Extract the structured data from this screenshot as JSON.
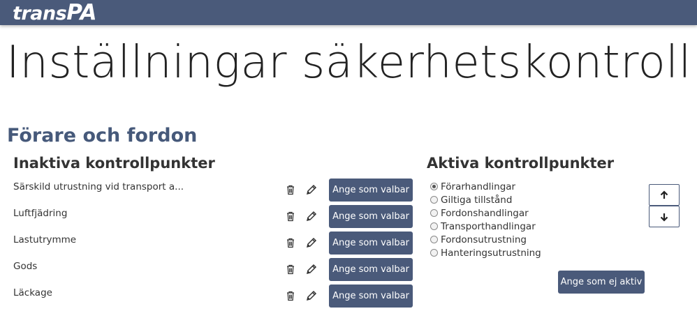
{
  "header": {
    "logo_trans": "trans",
    "logo_pa": "PA"
  },
  "page": {
    "title": "Inställningar säkerhetskontroll",
    "section_title": "Förare och fordon"
  },
  "inactive": {
    "heading": "Inaktiva kontrollpunkter",
    "items": [
      {
        "label": "Särskild utrustning vid transport a...",
        "button": "Ange som valbar"
      },
      {
        "label": "Luftfjädring",
        "button": "Ange som valbar"
      },
      {
        "label": "Lastutrymme",
        "button": "Ange som valbar"
      },
      {
        "label": "Gods",
        "button": "Ange som valbar"
      },
      {
        "label": "Läckage",
        "button": "Ange som valbar"
      }
    ]
  },
  "active": {
    "heading": "Aktiva kontrollpunkter",
    "selected_index": 0,
    "items": [
      "Förarhandlingar",
      "Giltiga tillstånd",
      "Fordonshandlingar",
      "Transporthandlingar",
      "Fordonsutrustning",
      "Hanteringsutrustning"
    ],
    "deactivate_button": "Ange som ej aktiv"
  },
  "icons": {
    "delete": "trash-icon",
    "edit": "pencil-icon",
    "move_up": "arrow-up-icon",
    "move_down": "arrow-down-icon"
  },
  "colors": {
    "header_bg": "#4a5a7a",
    "section_title": "#46597a",
    "button_bg": "#4a5a7a"
  }
}
